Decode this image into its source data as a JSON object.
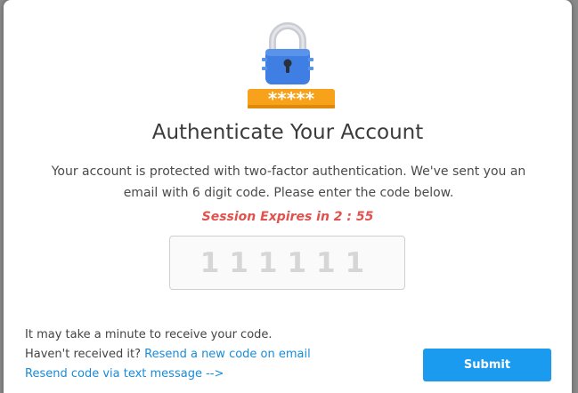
{
  "dialog": {
    "title": "Authenticate Your Account",
    "description": "Your account is protected with two-factor authentication. We've sent you an email with 6 digit code. Please enter the code below.",
    "session_expiry": "Session Expires in 2 : 55",
    "lock_badge_text": "*****"
  },
  "code_input": {
    "placeholder": "111111",
    "value": ""
  },
  "footer": {
    "info_text": "It may take a minute to receive your code.",
    "not_received_text": "Haven't received it?",
    "resend_email_link": "Resend a new code on email",
    "resend_text_link": "Resend code via text message -->"
  },
  "actions": {
    "submit_label": "Submit"
  },
  "colors": {
    "accent": "#1a9bf0",
    "link": "#1a8bd8",
    "expiry": "#e0524d",
    "lock_body": "#3f7fe3",
    "badge": "#f7a21a"
  },
  "icons": {
    "lock": "padlock-icon"
  }
}
